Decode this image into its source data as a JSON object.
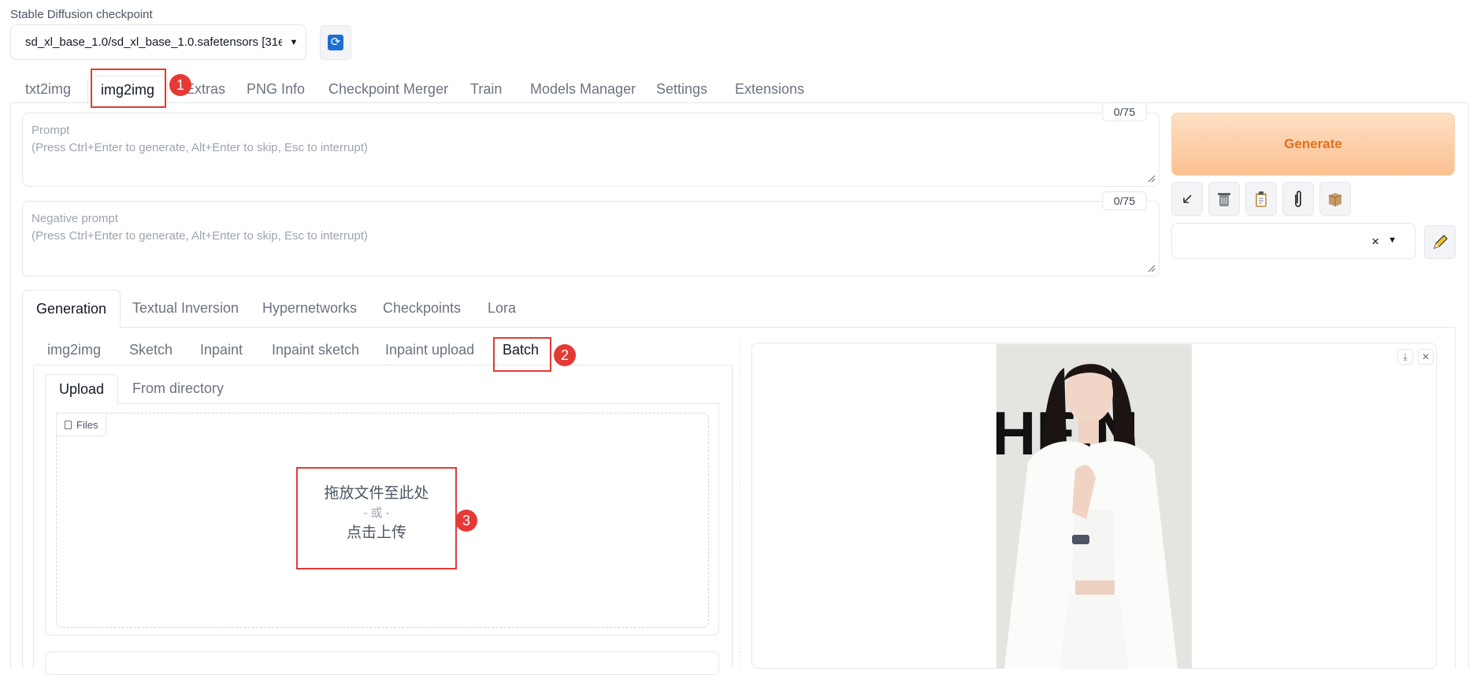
{
  "checkpoint": {
    "label": "Stable Diffusion checkpoint",
    "value": "sd_xl_base_1.0/sd_xl_base_1.0.safetensors [31e",
    "refresh_icon": "refresh-icon"
  },
  "main_tabs": [
    "txt2img",
    "img2img",
    "Extras",
    "PNG Info",
    "Checkpoint Merger",
    "Train",
    "Models Manager",
    "Settings",
    "Extensions"
  ],
  "prompt": {
    "label": "Prompt",
    "hint": "(Press Ctrl+Enter to generate, Alt+Enter to skip, Esc to interrupt)",
    "counter": "0/75"
  },
  "negative_prompt": {
    "label": "Negative prompt",
    "hint": "(Press Ctrl+Enter to generate, Alt+Enter to skip, Esc to interrupt)",
    "counter": "0/75"
  },
  "generate_label": "Generate",
  "tool_icons": [
    "arrow-icon",
    "trash-icon",
    "clipboard-icon",
    "paperclip-icon",
    "box-icon"
  ],
  "styles_clear": "×",
  "sub_tabs": [
    "Generation",
    "Textual Inversion",
    "Hypernetworks",
    "Checkpoints",
    "Lora"
  ],
  "mode_tabs": [
    "img2img",
    "Sketch",
    "Inpaint",
    "Inpaint sketch",
    "Inpaint upload",
    "Batch"
  ],
  "upload_tabs": [
    "Upload",
    "From directory"
  ],
  "dropzone": {
    "files_label": "Files",
    "line1": "拖放文件至此处",
    "line2": "- 或 -",
    "line3": "点击上传"
  },
  "gallery": {
    "download_icon": "download-icon",
    "close_icon": "close-icon",
    "photo_text": "HEIN"
  },
  "badges": [
    "1",
    "2",
    "3"
  ],
  "colors": {
    "accent": "#e0701b",
    "highlight": "#e53935",
    "refresh": "#1d6fd1"
  }
}
